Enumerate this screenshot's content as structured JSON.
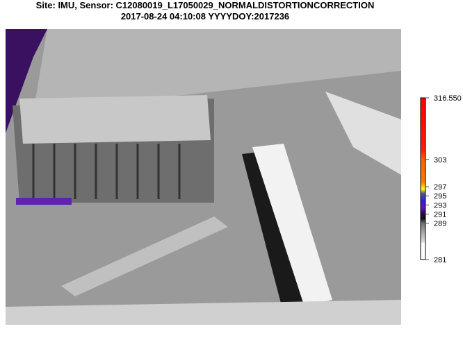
{
  "title": {
    "line1": "Site: IMU, Sensor: C12080019_L17050029_NORMALDISTORTIONCORRECTION",
    "line2": "2017-08-24 04:10:08 YYYYDOY:2017236"
  },
  "chart_data": {
    "type": "heatmap",
    "title": "Site: IMU, Sensor: C12080019_L17050029_NORMALDISTORTIONCORRECTION 2017-08-24 04:10:08 YYYYDOY:2017236",
    "colorbar": {
      "range": [
        281,
        316.55
      ],
      "ticks": [
        316.55,
        303,
        297,
        295,
        293,
        291,
        289,
        281
      ],
      "tick_labels": [
        "316.550",
        "303",
        "297",
        "295",
        "293",
        "291",
        "289",
        "281"
      ],
      "stops": [
        {
          "value": 281,
          "color": "#ffffff"
        },
        {
          "value": 284.5,
          "color": "#ffffff"
        },
        {
          "value": 285,
          "color": "#d8d8d8"
        },
        {
          "value": 287,
          "color": "#a8a8a8"
        },
        {
          "value": 289,
          "color": "#707070"
        },
        {
          "value": 290,
          "color": "#101010"
        },
        {
          "value": 291,
          "color": "#2a0a40"
        },
        {
          "value": 292.5,
          "color": "#6a10c0"
        },
        {
          "value": 294,
          "color": "#3020e0"
        },
        {
          "value": 295.5,
          "color": "#5050a0"
        },
        {
          "value": 296.5,
          "color": "#ffff00"
        },
        {
          "value": 298,
          "color": "#ff7a00"
        },
        {
          "value": 303,
          "color": "#ff6000"
        },
        {
          "value": 305,
          "color": "#ff2000"
        },
        {
          "value": 316.55,
          "color": "#ff0000"
        }
      ]
    }
  }
}
